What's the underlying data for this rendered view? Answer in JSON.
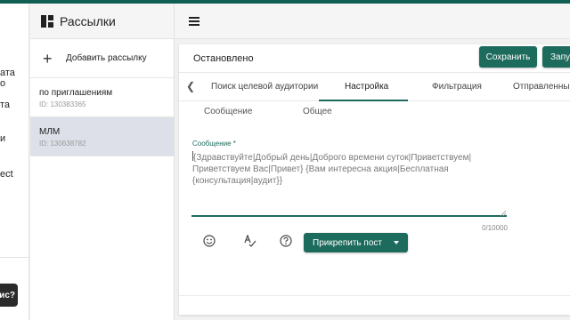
{
  "left_sidebar": {
    "fragments": [
      "ата",
      "о",
      "та",
      "и",
      "ect"
    ],
    "bottom_button": "ис?"
  },
  "mailings": {
    "title": "Рассылки",
    "add_label": "Добавить рассылку",
    "items": [
      {
        "name": "по приглашениям",
        "id": "ID: 130383365"
      },
      {
        "name": "МЛМ",
        "id": "ID: 130638782"
      }
    ]
  },
  "editor": {
    "status": "Остановлено",
    "save_label": "Сохранить",
    "run_label": "Запу",
    "tabs": [
      "Поиск целевой аудитории",
      "Настройка",
      "Фильтрация",
      "Отправленные с"
    ],
    "subtabs": [
      "Сообщение",
      "Общее"
    ],
    "message_label": "Сообщение",
    "required_mark": "*",
    "message_lines": [
      "{Здравствуйте|Добрый день|Доброго времени суток|Приветствуем|",
      "Приветствуем Вас|Привет} {Вам интересна акция|Бесплатная",
      "{консультация|аудит}}"
    ],
    "counter": "0/10000",
    "pin_label": "Прикрепить пост"
  },
  "colors": {
    "accent": "#1d6b5c",
    "topbar": "#0f5f52"
  },
  "icons": [
    "grid-icon",
    "plus-icon",
    "menu-icon",
    "chevron-left-icon",
    "emoji-icon",
    "spellcheck-icon",
    "help-icon",
    "dropdown-arrow-icon"
  ]
}
